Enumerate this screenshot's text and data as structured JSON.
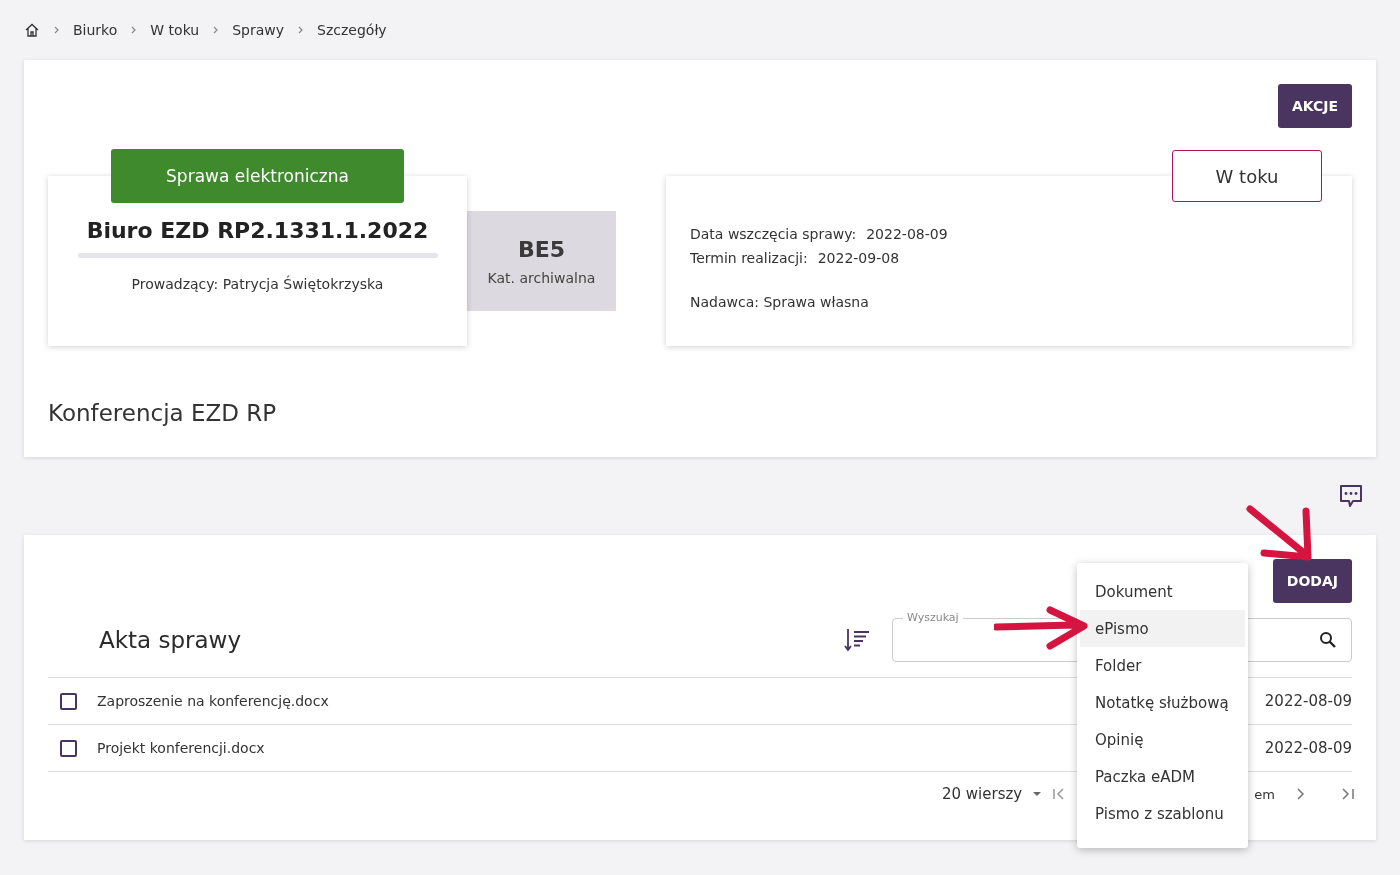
{
  "breadcrumb": [
    "Biurko",
    "W toku",
    "Sprawy",
    "Szczegóły"
  ],
  "actions_button": "AKCJE",
  "case": {
    "type_label": "Sprawa elektroniczna",
    "number": "Biuro EZD RP2.1331.1.2022",
    "lead": "Prowadzący: Patrycja Świętokrzyska"
  },
  "category": {
    "code": "BE5",
    "label": "Kat. archiwalna"
  },
  "status": "W toku",
  "details": [
    {
      "label": "Data wszczęcia sprawy:",
      "value": "2022-08-09"
    },
    {
      "label": "Termin realizacji:",
      "value": "2022-09-08"
    }
  ],
  "sender": "Nadawca: Sprawa własna",
  "title": "Konferencja EZD RP",
  "files": {
    "add_button": "DODAJ",
    "heading": "Akta sprawy",
    "search": {
      "label": "Wyszukaj"
    },
    "rows": [
      {
        "name": "Zaproszenie na konferencję.docx",
        "date": "2022-08-09",
        "checked": false
      },
      {
        "name": "Projekt konferencji.docx",
        "date": "2022-08-09",
        "checked": false
      }
    ],
    "pagination": {
      "rows_per_page": "20 wierszy",
      "range_fragment": "em"
    }
  },
  "add_menu": {
    "items": [
      {
        "label": "Dokument",
        "selected": false
      },
      {
        "label": "ePismo",
        "selected": true
      },
      {
        "label": "Folder",
        "selected": false
      },
      {
        "label": "Notatkę służbową",
        "selected": false
      },
      {
        "label": "Opinię",
        "selected": false
      },
      {
        "label": "Paczka eADM",
        "selected": false
      },
      {
        "label": "Pismo z szablonu",
        "selected": false
      }
    ]
  }
}
